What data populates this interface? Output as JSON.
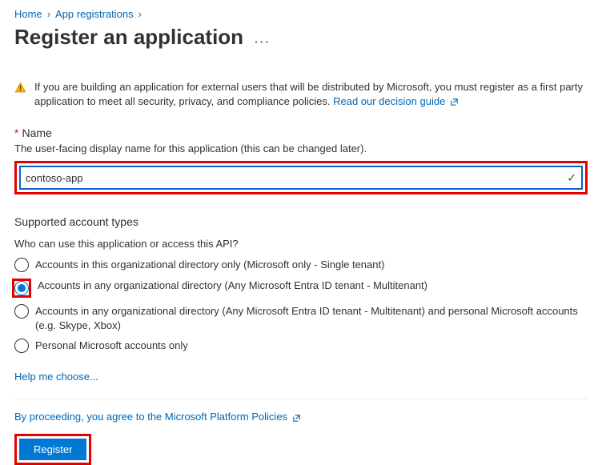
{
  "breadcrumb": {
    "home": "Home",
    "app_reg": "App registrations"
  },
  "page_title": "Register an application",
  "warning": {
    "text_a": "If you are building an application for external users that will be distributed by Microsoft, you must register as a first party application to meet all security, privacy, and compliance policies. ",
    "link": "Read our decision guide"
  },
  "name_section": {
    "label": "Name",
    "help": "The user-facing display name for this application (this can be changed later).",
    "value": "contoso-app"
  },
  "account_types": {
    "heading": "Supported account types",
    "question": "Who can use this application or access this API?",
    "opt1": "Accounts in this organizational directory only (Microsoft only - Single tenant)",
    "opt2": "Accounts in any organizational directory (Any Microsoft Entra ID tenant - Multitenant)",
    "opt3": "Accounts in any organizational directory (Any Microsoft Entra ID tenant - Multitenant) and personal Microsoft accounts (e.g. Skype, Xbox)",
    "opt4": "Personal Microsoft accounts only",
    "help_link": "Help me choose..."
  },
  "footer": {
    "agree": "By proceeding, you agree to the Microsoft Platform Policies",
    "register": "Register"
  }
}
